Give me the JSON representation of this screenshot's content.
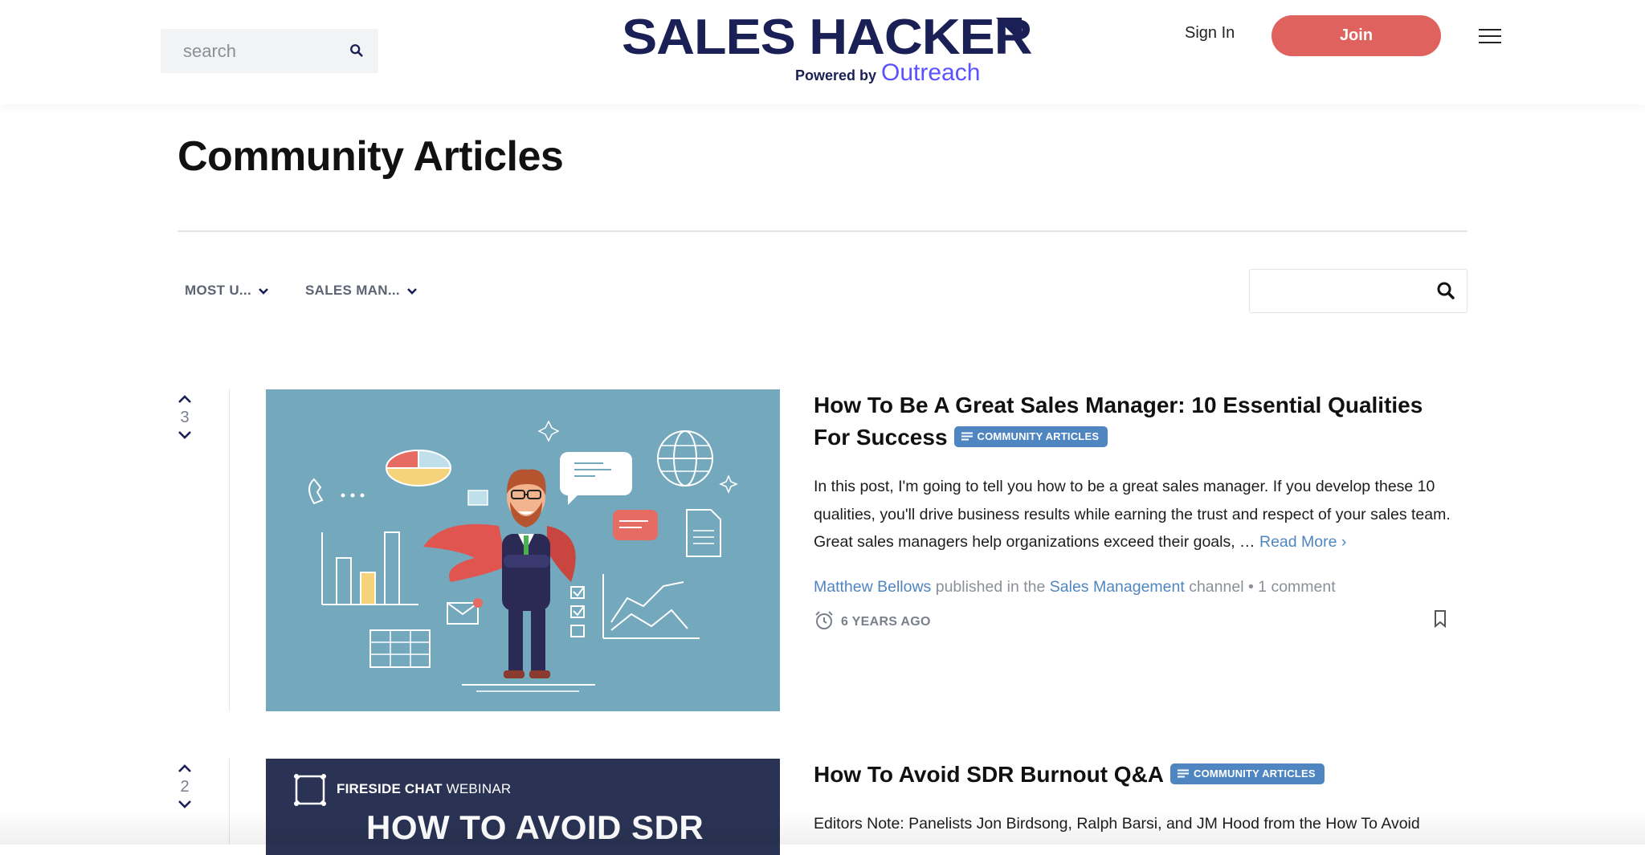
{
  "header": {
    "search_placeholder": "search",
    "logo_title": "SALES HACKER",
    "logo_powered_by": "Powered by",
    "logo_brand": "Outreach",
    "sign_in_label": "Sign In",
    "join_label": "Join"
  },
  "page": {
    "title": "Community Articles"
  },
  "filters": {
    "sort_label": "MOST U...",
    "category_label": "SALES MAN..."
  },
  "articles": [
    {
      "votes": "3",
      "title": "How To Be A Great Sales Manager: 10 Essential Qualities For Success",
      "badge": "COMMUNITY ARTICLES",
      "excerpt": "In this post, I'm going to tell you how to be a great sales manager. If you develop these 10 qualities, you'll drive business results while earning the trust and respect of your sales team. Great sales managers help organizations exceed their goals, … ",
      "read_more": "Read More ›",
      "author": "Matthew Bellows",
      "published_text": " published in the ",
      "channel": "Sales Management",
      "channel_suffix": " channel • 1 comment",
      "time": "6 YEARS AGO"
    },
    {
      "votes": "2",
      "title": "How To Avoid SDR Burnout Q&A",
      "badge": "COMMUNITY ARTICLES",
      "excerpt": "Editors Note: Panelists Jon Birdsong, Ralph Barsi, and JM Hood from the How To Avoid",
      "thumb_kicker_bold": "FIRESIDE CHAT",
      "thumb_kicker_light": " WEBINAR",
      "thumb_headline": "HOW TO AVOID SDR"
    }
  ],
  "colors": {
    "brand_navy": "#1a1f56",
    "brand_purple": "#5952ff",
    "join_red": "#e0625f",
    "link_blue": "#4f85c0",
    "thumb1_bg": "#74a8bc",
    "thumb2_bg": "#2a3354"
  },
  "icons": [
    "search-icon",
    "chevron-down-icon",
    "menu-icon",
    "upvote-icon",
    "downvote-icon",
    "list-icon",
    "alarm-clock-icon",
    "bookmark-icon",
    "frame-logo-icon"
  ]
}
